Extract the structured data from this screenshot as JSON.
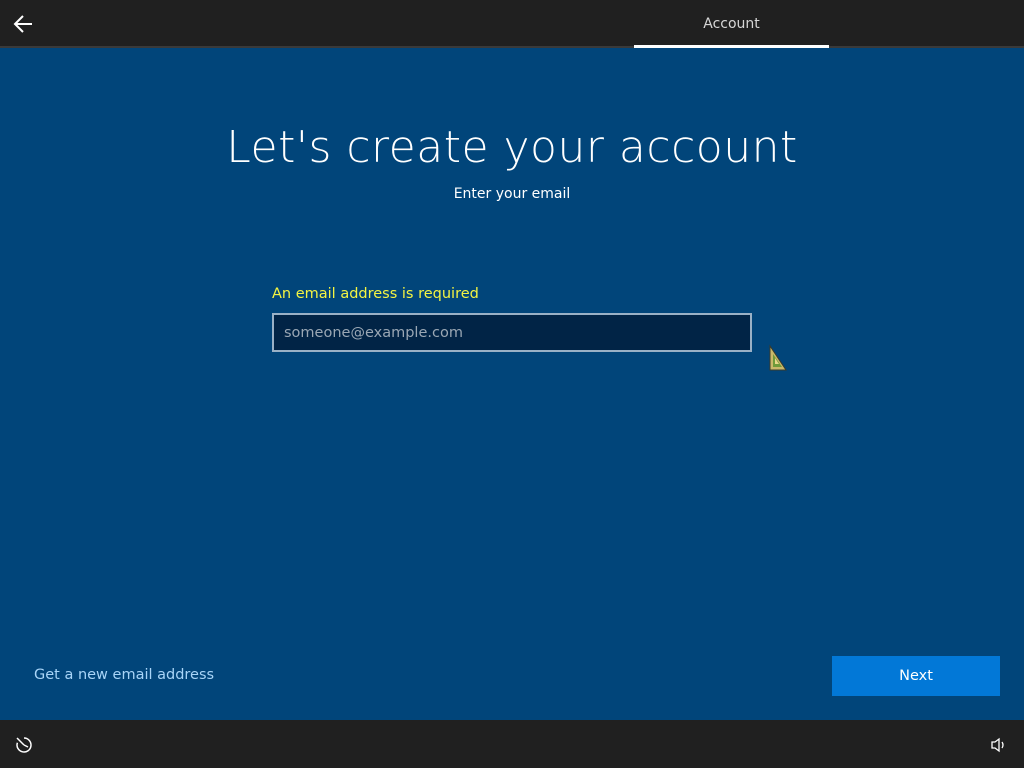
{
  "header": {
    "back_icon": "back-arrow-icon",
    "tab_label": "Account"
  },
  "main": {
    "title": "Let's create your account",
    "subtitle": "Enter your email",
    "error_message": "An email address is required",
    "email": {
      "value": "",
      "placeholder": "someone@example.com"
    }
  },
  "footer": {
    "new_email_link": "Get a new email address",
    "next_label": "Next",
    "ease_of_access_icon": "ease-of-access-icon",
    "volume_icon": "volume-icon"
  },
  "colors": {
    "background": "#01457a",
    "bar": "#202020",
    "accent": "#0278d7",
    "error": "#f4f442",
    "link": "#a8d4f7"
  }
}
